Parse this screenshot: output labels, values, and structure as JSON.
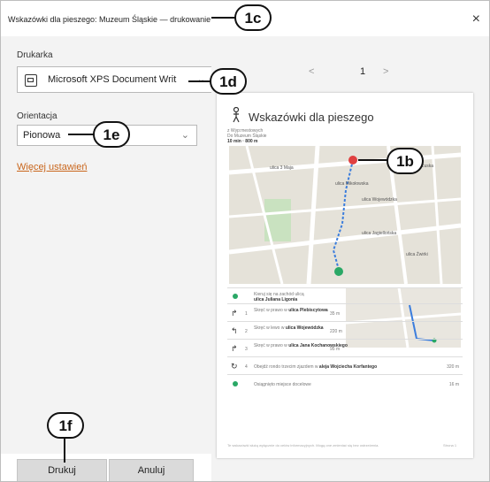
{
  "window": {
    "title": "Wskazówki dla pieszego: Muzeum Śląskie — drukowanie",
    "close_symbol": "×"
  },
  "printer": {
    "label": "Drukarka",
    "value": "Microsoft XPS Document Writ"
  },
  "orientation": {
    "label": "Orientacja",
    "value": "Pionowa"
  },
  "more_settings": "Więcej ustawień",
  "buttons": {
    "print": "Drukuj",
    "cancel": "Anuluj"
  },
  "preview": {
    "prev": "<",
    "next": ">",
    "page_number": "1",
    "title": "Wskazówki dla pieszego",
    "meta": [
      "z   Wyp:mestowych",
      "Do   Muzeum Śląskie",
      "10 min · 800 m"
    ],
    "map_streets": [
      "ulica 3 Maja",
      "ulica Mikołowska",
      "ulica Wojewódzka",
      "ulica Jagiellońska",
      "ulica Francuska",
      "ulica Żwirki"
    ],
    "steps": [
      {
        "num": "",
        "text": "Kieruj się na zachód ulicą",
        "bold": "ulica Juliana Ligonia",
        "dist": ""
      },
      {
        "num": "1",
        "text": "Skręć w prawo w",
        "bold": "ulica Plebiscytowa",
        "dist": "35 m"
      },
      {
        "num": "2",
        "text": "Skręć w lewo w",
        "bold": "ulica Wojewódzka",
        "dist": "220 m"
      },
      {
        "num": "3",
        "text": "Skręć w prawo w",
        "bold": "ulica Jana Kochanowskiego",
        "dist": "95 m"
      },
      {
        "num": "4",
        "text": "Obejdź rondo trzecim zjazdem w",
        "bold": "aleja Wojciecha Korfantego",
        "dist": "320 m"
      },
      {
        "num": "",
        "text": "Osiągnięto miejsce docelowe",
        "bold": "",
        "dist": "16 m"
      }
    ],
    "footer_left": "Te wskazówki służą wyłącznie do celów informacyjnych. Mogą one zmieniać się bez ostrzeżenia.",
    "footer_right": "Strona 1"
  },
  "callouts": {
    "c1c": "1c",
    "c1d": "1d",
    "c1e": "1e",
    "c1b": "1b",
    "c1f": "1f"
  },
  "colors": {
    "link": "#c9661c",
    "route": "#3b7ddd",
    "start": "#2aa866",
    "pin": "#e04040"
  }
}
